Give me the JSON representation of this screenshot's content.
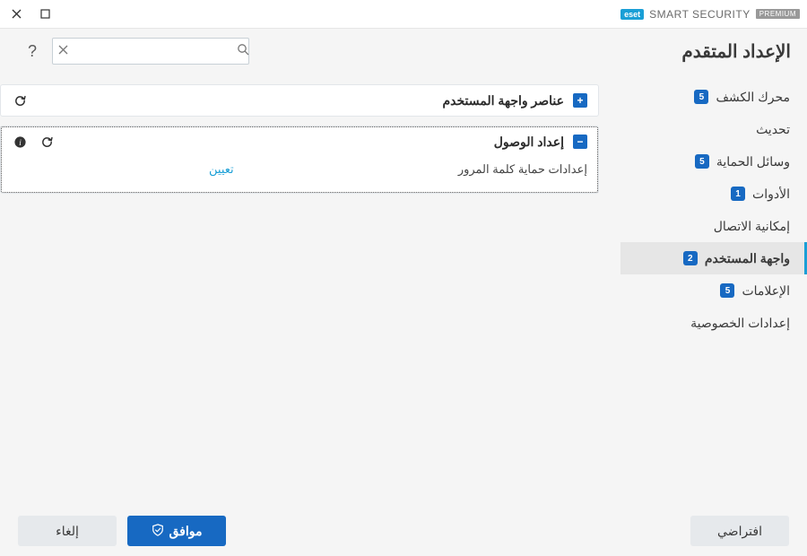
{
  "brand": {
    "badge": "eset",
    "text": "SMART SECURITY",
    "premium": "PREMIUM"
  },
  "page_title": "الإعداد المتقدم",
  "search": {
    "placeholder": ""
  },
  "sidebar": {
    "items": [
      {
        "label": "محرك الكشف",
        "badge": "5"
      },
      {
        "label": "تحديث",
        "badge": null
      },
      {
        "label": "وسائل الحماية",
        "badge": "5"
      },
      {
        "label": "الأدوات",
        "badge": "1"
      },
      {
        "label": "إمكانية الاتصال",
        "badge": null
      },
      {
        "label": "واجهة المستخدم",
        "badge": "2"
      },
      {
        "label": "الإعلامات",
        "badge": "5"
      },
      {
        "label": "إعدادات الخصوصية",
        "badge": null
      }
    ],
    "active_index": 5
  },
  "panels": {
    "ui_elements": {
      "title": "عناصر واجهة المستخدم",
      "expanded": false
    },
    "access": {
      "title": "إعداد الوصول",
      "expanded": true,
      "rows": [
        {
          "label": "إعدادات حماية كلمة المرور",
          "action": "تعيين"
        }
      ]
    }
  },
  "footer": {
    "default": "افتراضي",
    "ok": "موافق",
    "cancel": "إلغاء"
  }
}
